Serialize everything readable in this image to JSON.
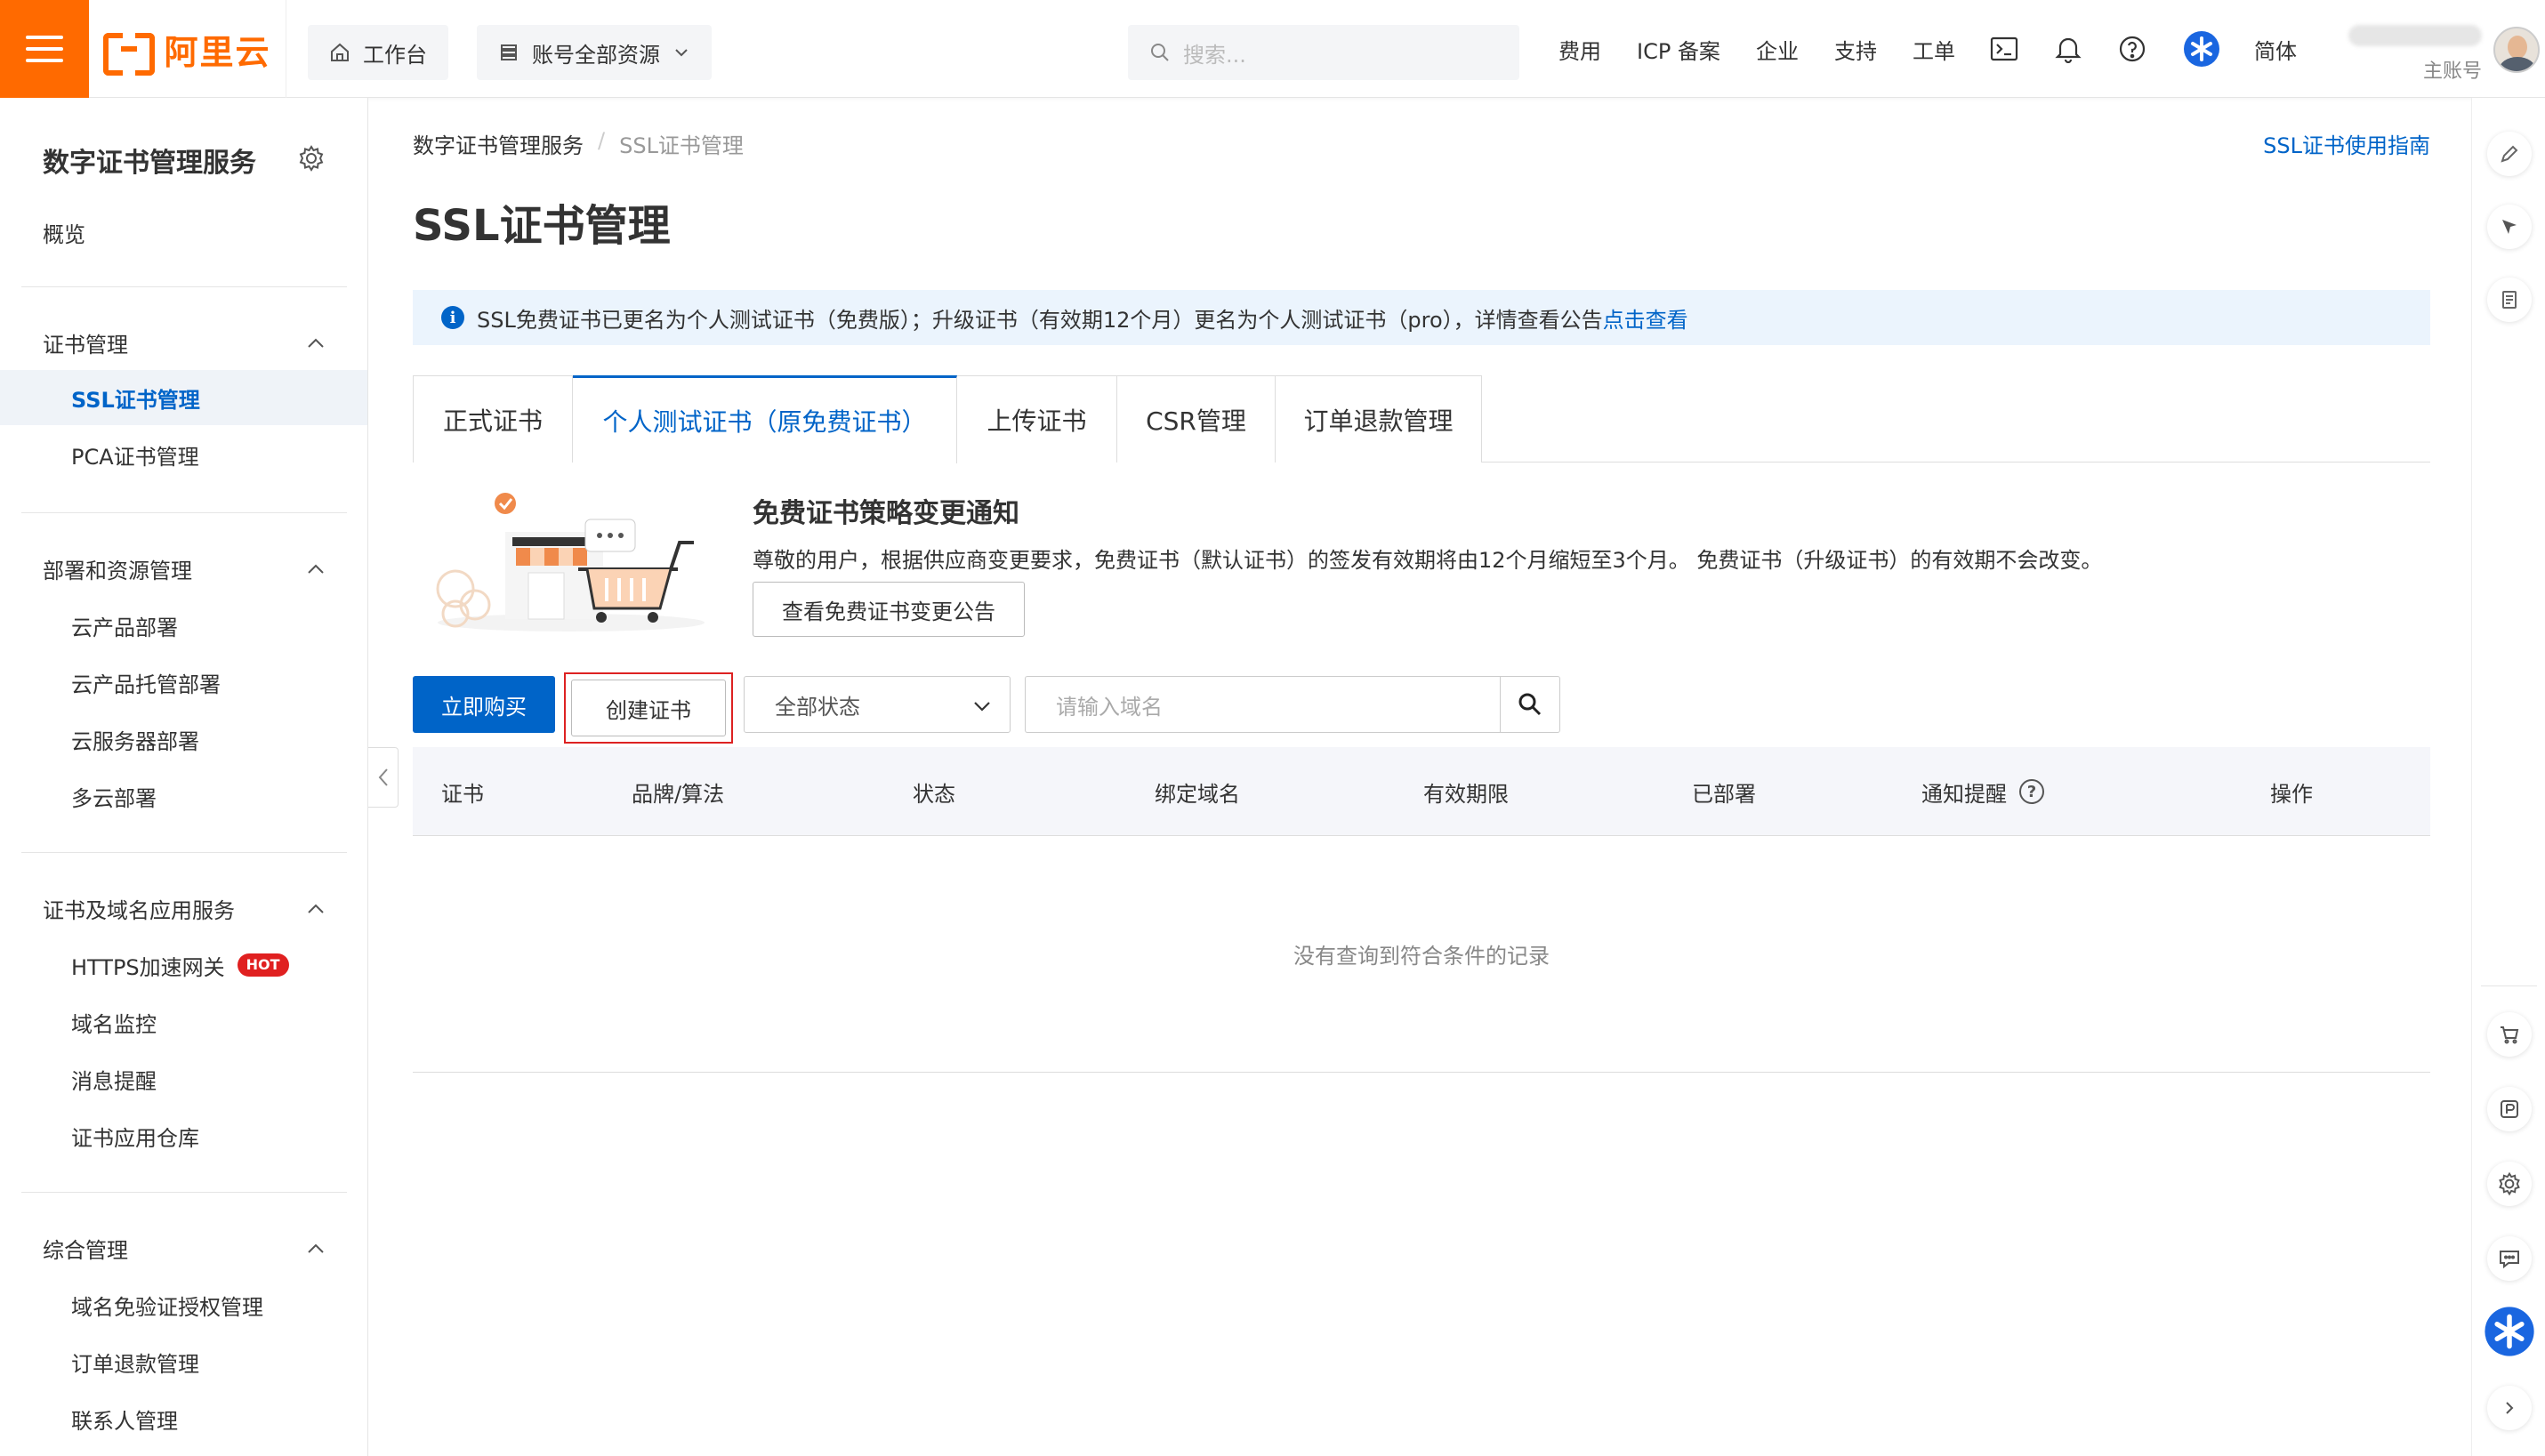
{
  "topbar": {
    "logo_text": "阿里云",
    "workbench_label": "工作台",
    "resources_label": "账号全部资源",
    "search_placeholder": "搜索...",
    "nav": [
      "费用",
      "ICP 备案",
      "企业",
      "支持",
      "工单"
    ],
    "lang": "简体",
    "account_sub": "主账号"
  },
  "sidebar": {
    "title": "数字证书管理服务",
    "overview": "概览",
    "groups": [
      {
        "label": "证书管理",
        "items": [
          "SSL证书管理",
          "PCA证书管理"
        ]
      },
      {
        "label": "部署和资源管理",
        "items": [
          "云产品部署",
          "云产品托管部署",
          "云服务器部署",
          "多云部署"
        ]
      },
      {
        "label": "证书及域名应用服务",
        "items": [
          "HTTPS加速网关",
          "域名监控",
          "消息提醒",
          "证书应用仓库"
        ]
      },
      {
        "label": "综合管理",
        "items": [
          "域名免验证授权管理",
          "订单退款管理",
          "联系人管理"
        ]
      }
    ],
    "hot_badge": "HOT"
  },
  "main": {
    "breadcrumb": [
      "数字证书管理服务",
      "SSL证书管理"
    ],
    "guide_link": "SSL证书使用指南",
    "title": "SSL证书管理",
    "notice_text": "SSL免费证书已更名为个人测试证书（免费版）；升级证书（有效期12个月）更名为个人测试证书（pro），详情查看公告",
    "notice_link": "点击查看",
    "tabs": [
      "正式证书",
      "个人测试证书（原免费证书）",
      "上传证书",
      "CSR管理",
      "订单退款管理"
    ],
    "policy": {
      "title": "免费证书策略变更通知",
      "desc": "尊敬的用户，根据供应商变更要求，免费证书（默认证书）的签发有效期将由12个月缩短至3个月。 免费证书（升级证书）的有效期不会改变。",
      "button": "查看免费证书变更公告"
    },
    "toolbar": {
      "buy": "立即购买",
      "create": "创建证书",
      "status_select": "全部状态",
      "domain_placeholder": "请输入域名"
    },
    "table": {
      "columns": [
        "证书",
        "品牌/算法",
        "状态",
        "绑定域名",
        "有效期限",
        "已部署",
        "通知提醒",
        "操作"
      ],
      "empty": "没有查询到符合条件的记录"
    }
  },
  "colors": {
    "brand": "#ff6a00",
    "primary": "#0064c8",
    "hot": "#e02020"
  }
}
